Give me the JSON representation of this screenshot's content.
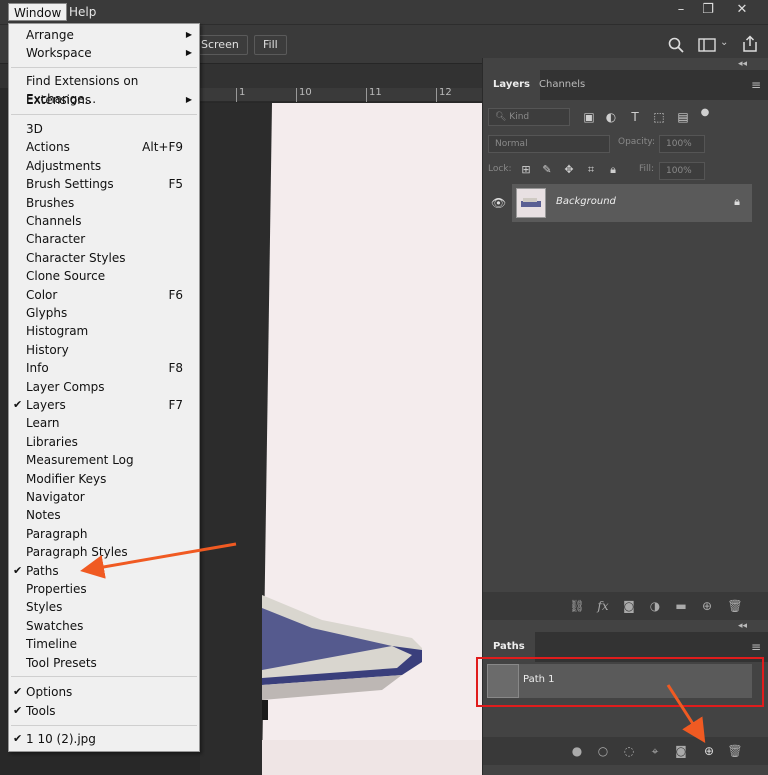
{
  "menubar": {
    "items": [
      "Window",
      "Help"
    ]
  },
  "window_controls": [
    "–",
    "❐",
    "✕"
  ],
  "options_bar": {
    "screen_label": "Screen",
    "fill_label": "Fill"
  },
  "ruler": {
    "ticks": [
      "1",
      "10",
      "11",
      "12"
    ]
  },
  "window_menu": {
    "items": [
      {
        "label": "Arrange",
        "shortcut": "",
        "submenu": true,
        "checked": false
      },
      {
        "label": "Workspace",
        "shortcut": "",
        "submenu": true,
        "checked": false
      },
      {
        "label": "Find Extensions on Exchange...",
        "shortcut": "",
        "submenu": false,
        "checked": false
      },
      {
        "label": "Extensions",
        "shortcut": "",
        "submenu": true,
        "checked": false
      },
      {
        "label": "3D",
        "shortcut": "",
        "submenu": false,
        "checked": false
      },
      {
        "label": "Actions",
        "shortcut": "Alt+F9",
        "submenu": false,
        "checked": false
      },
      {
        "label": "Adjustments",
        "shortcut": "",
        "submenu": false,
        "checked": false
      },
      {
        "label": "Brush Settings",
        "shortcut": "F5",
        "submenu": false,
        "checked": false
      },
      {
        "label": "Brushes",
        "shortcut": "",
        "submenu": false,
        "checked": false
      },
      {
        "label": "Channels",
        "shortcut": "",
        "submenu": false,
        "checked": false
      },
      {
        "label": "Character",
        "shortcut": "",
        "submenu": false,
        "checked": false
      },
      {
        "label": "Character Styles",
        "shortcut": "",
        "submenu": false,
        "checked": false
      },
      {
        "label": "Clone Source",
        "shortcut": "",
        "submenu": false,
        "checked": false
      },
      {
        "label": "Color",
        "shortcut": "F6",
        "submenu": false,
        "checked": false
      },
      {
        "label": "Glyphs",
        "shortcut": "",
        "submenu": false,
        "checked": false
      },
      {
        "label": "Histogram",
        "shortcut": "",
        "submenu": false,
        "checked": false
      },
      {
        "label": "History",
        "shortcut": "",
        "submenu": false,
        "checked": false
      },
      {
        "label": "Info",
        "shortcut": "F8",
        "submenu": false,
        "checked": false
      },
      {
        "label": "Layer Comps",
        "shortcut": "",
        "submenu": false,
        "checked": false
      },
      {
        "label": "Layers",
        "shortcut": "F7",
        "submenu": false,
        "checked": true
      },
      {
        "label": "Learn",
        "shortcut": "",
        "submenu": false,
        "checked": false
      },
      {
        "label": "Libraries",
        "shortcut": "",
        "submenu": false,
        "checked": false
      },
      {
        "label": "Measurement Log",
        "shortcut": "",
        "submenu": false,
        "checked": false
      },
      {
        "label": "Modifier Keys",
        "shortcut": "",
        "submenu": false,
        "checked": false
      },
      {
        "label": "Navigator",
        "shortcut": "",
        "submenu": false,
        "checked": false
      },
      {
        "label": "Notes",
        "shortcut": "",
        "submenu": false,
        "checked": false
      },
      {
        "label": "Paragraph",
        "shortcut": "",
        "submenu": false,
        "checked": false
      },
      {
        "label": "Paragraph Styles",
        "shortcut": "",
        "submenu": false,
        "checked": false
      },
      {
        "label": "Paths",
        "shortcut": "",
        "submenu": false,
        "checked": true
      },
      {
        "label": "Properties",
        "shortcut": "",
        "submenu": false,
        "checked": false
      },
      {
        "label": "Styles",
        "shortcut": "",
        "submenu": false,
        "checked": false
      },
      {
        "label": "Swatches",
        "shortcut": "",
        "submenu": false,
        "checked": false
      },
      {
        "label": "Timeline",
        "shortcut": "",
        "submenu": false,
        "checked": false
      },
      {
        "label": "Tool Presets",
        "shortcut": "",
        "submenu": false,
        "checked": false
      },
      {
        "label": "Options",
        "shortcut": "",
        "submenu": false,
        "checked": true
      },
      {
        "label": "Tools",
        "shortcut": "",
        "submenu": false,
        "checked": true
      },
      {
        "label": "1 10 (2).jpg",
        "shortcut": "",
        "submenu": false,
        "checked": true
      }
    ]
  },
  "layers_panel": {
    "tabs": [
      "Layers",
      "Channels"
    ],
    "kind_placeholder": "Kind",
    "blend_mode": "Normal",
    "opacity_label": "Opacity:",
    "opacity_value": "100%",
    "lock_label": "Lock:",
    "fill_label": "Fill:",
    "fill_value": "100%",
    "layer_name": "Background"
  },
  "paths_panel": {
    "tab": "Paths",
    "path_name": "Path 1"
  },
  "colors": {
    "highlight_box": "#e01c1c",
    "arrow": "#f05a22",
    "photo_bg": "#f4eced"
  }
}
